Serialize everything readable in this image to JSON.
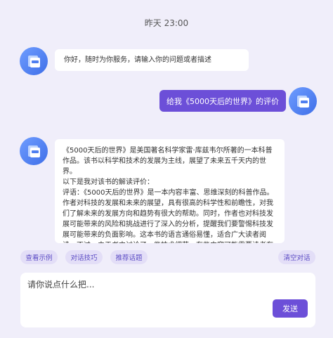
{
  "timestamp": "昨天 23:00",
  "messages": {
    "greeting": "你好，随时为你服务，请输入你的问题或者描述",
    "user_query": "给我《5000天后的世界》的评价",
    "reply": {
      "p1": "《5000天后的世界》是美国著名科学家雷·库兹韦尔所著的一本科普作品。该书以科学和技术的发展为主线，展望了未来五千天内的世界。",
      "p2": "以下是我对该书的解读评价：",
      "p3": "评语：《5000天后的世界》是一本内容丰富、思维深刻的科普作品。作者对科技的发展和未来的展望，具有很高的科学性和前瞻性，对我们了解未来的发展方向和趋势有很大的帮助。同时，作者也对科技发展可能带来的风险和挑战进行了深入的分析，提醒我们要警惕科技发展可能带来的负面影响。这本书的语言通俗易懂，适合广大读者阅读。不过，由于书中讨论了一些技术细节，有些内容可能需要读者有一定的科学背景才能更好的理解。总之，这本书是一本值得一读的科学著作。"
    }
  },
  "chips": {
    "examples": "查看示例",
    "tips": "对话技巧",
    "recommend": "推荐话题",
    "clear": "清空对话"
  },
  "input": {
    "placeholder": "请你说点什么把...",
    "send_label": "发送"
  },
  "colors": {
    "accent": "#6c4fd8",
    "background": "#f0eefa",
    "chip_bg": "#e3def7",
    "avatar": "#4f7ff0"
  },
  "icons": {
    "avatar": "app-card-icon"
  }
}
